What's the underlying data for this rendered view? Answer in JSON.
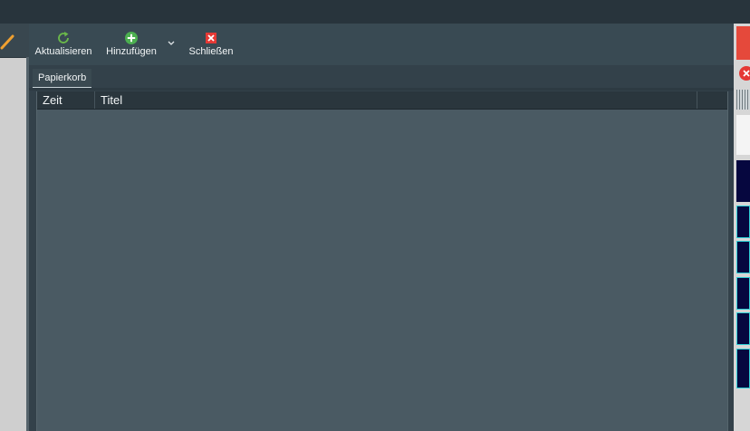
{
  "toolbar": {
    "refresh_label": "Aktualisieren",
    "add_label": "Hinzufügen",
    "close_label": "Schließen"
  },
  "tabs": [
    {
      "label": "Papierkorb",
      "active": true
    }
  ],
  "table": {
    "columns": [
      "Zeit",
      "Titel"
    ],
    "rows": []
  },
  "icons": {
    "left": "pencil-icon",
    "refresh": "refresh-icon",
    "add": "plus-circle-icon",
    "dropdown": "chevron-down-icon",
    "close": "close-x-icon",
    "right_close": "close-circle-icon"
  },
  "colors": {
    "background": "#33414a",
    "toolbar": "#394a53",
    "table_body": "#4a5a63",
    "table_header": "#2a363d",
    "refresh_green": "#6bb94a",
    "add_green": "#4caf50",
    "close_red": "#e53935",
    "accent_orange": "#f0a030",
    "navy": "#06073f",
    "cyan_outline": "#2ecfd6"
  }
}
